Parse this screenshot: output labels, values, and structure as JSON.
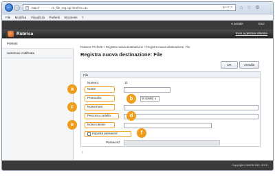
{
  "browser": {
    "url": "http://············/a_file_reg.cgi.html?nc=11",
    "addr_tools": "ρ • c ×",
    "icons": [
      "home-icon",
      "star-icon",
      "gear-icon"
    ]
  },
  "menubar": [
    "File",
    "Modifica",
    "Visualizza",
    "Preferiti",
    "Strumenti",
    "?"
  ],
  "header": {
    "portal": "A portale",
    "exit": "Esci",
    "app_title": "Rubrica",
    "system_link": "Invio a gestore sistema"
  },
  "sidebar": {
    "items": [
      {
        "label": "Preferiti"
      },
      {
        "label": "Selezione codificata"
      }
    ]
  },
  "main": {
    "breadcrumb": "Rubrica: Preferiti > Registra nuova destinazione > Registra nuova destinazione: File",
    "title": "Registra nuova destinazione: File",
    "ok_label": "OK",
    "cancel_label": "Annulla",
    "section_title": "File",
    "fields": {
      "numero_label": "Numero:",
      "numero_value": "11",
      "nome_label": "Nome",
      "protocollo_label": "Protocollo:",
      "protocollo_value": "W (SMB) ∨",
      "nome_host_label": "Nome host:",
      "percorso_label": "Percorso cartella:",
      "nome_utente_label": "Nome utente:",
      "password_check_label": "Imposta password",
      "password_label": "Password:"
    },
    "to_top": "↑"
  },
  "badges": [
    "a",
    "b",
    "c",
    "d",
    "e",
    "f"
  ],
  "footer": "Copyright CANON INC. 2015",
  "colors": {
    "accent": "#ef9d1a",
    "header_bg": "#3a3a3a"
  }
}
